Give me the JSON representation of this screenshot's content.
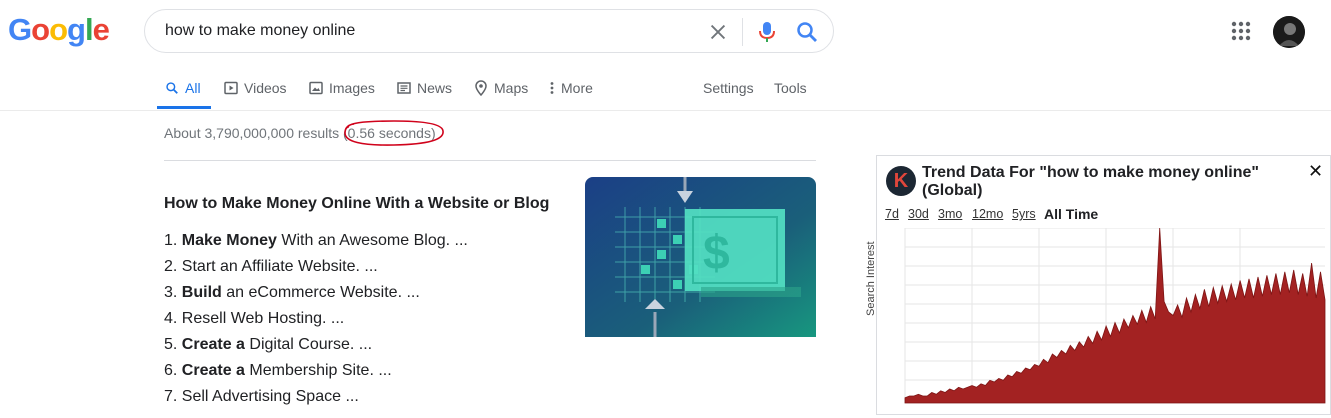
{
  "logo": {
    "letters": [
      "G",
      "o",
      "o",
      "g",
      "l",
      "e"
    ],
    "colors": [
      "#4285F4",
      "#EA4335",
      "#FBBC05",
      "#4285F4",
      "#34A853",
      "#EA4335"
    ]
  },
  "search": {
    "query": "how to make money online"
  },
  "icons": {
    "clear": "close-icon",
    "mic": "microphone-icon",
    "search": "search-icon",
    "apps": "apps-grid-icon"
  },
  "tabs": [
    {
      "label": "All",
      "icon": "search-icon"
    },
    {
      "label": "Videos",
      "icon": "play-icon"
    },
    {
      "label": "Images",
      "icon": "image-icon"
    },
    {
      "label": "News",
      "icon": "news-icon"
    },
    {
      "label": "Maps",
      "icon": "map-pin-icon"
    },
    {
      "label": "More",
      "icon": "more-vert-icon"
    }
  ],
  "tools": {
    "settings": "Settings",
    "tools": "Tools"
  },
  "stats": {
    "text": "About 3,790,000,000 results (0.56 seconds)"
  },
  "snippet": {
    "title": "How to Make Money Online With a Website or Blog",
    "items": [
      {
        "num": "1.",
        "bold": "Make Money",
        "rest": " With an Awesome Blog. ..."
      },
      {
        "num": "2.",
        "bold": "",
        "rest": "Start an Affiliate Website. ..."
      },
      {
        "num": "3.",
        "bold": "Build",
        "rest": " an eCommerce Website. ..."
      },
      {
        "num": "4.",
        "bold": "",
        "rest": "Resell Web Hosting. ..."
      },
      {
        "num": "5.",
        "bold": "Create a",
        "rest": " Digital Course. ..."
      },
      {
        "num": "6.",
        "bold": "Create a",
        "rest": " Membership Site. ..."
      },
      {
        "num": "7.",
        "bold": "",
        "rest": "Sell Advertising Space ..."
      }
    ]
  },
  "trend": {
    "logo_letter": "K",
    "title": "Trend Data For \"how to make money online\" (Global)",
    "close": "✕",
    "ranges": [
      "7d",
      "30d",
      "3mo",
      "12mo",
      "5yrs"
    ],
    "current_range": "All Time",
    "ylabel": "Search Interest",
    "color": "#a32222"
  },
  "chart_data": {
    "type": "area",
    "ylabel": "Search Interest",
    "ylim": [
      0,
      100
    ],
    "grid": true,
    "values": [
      3,
      4,
      4,
      5,
      4,
      4,
      6,
      5,
      7,
      6,
      8,
      7,
      9,
      8,
      9,
      10,
      9,
      11,
      10,
      13,
      12,
      14,
      13,
      16,
      15,
      18,
      17,
      20,
      19,
      22,
      21,
      25,
      23,
      28,
      26,
      30,
      28,
      33,
      30,
      35,
      32,
      38,
      34,
      41,
      36,
      44,
      38,
      46,
      40,
      48,
      43,
      50,
      45,
      53,
      46,
      55,
      48,
      100,
      58,
      52,
      50,
      56,
      49,
      60,
      52,
      62,
      54,
      65,
      55,
      66,
      57,
      67,
      58,
      68,
      59,
      70,
      60,
      71,
      60,
      72,
      61,
      73,
      62,
      74,
      62,
      75,
      63,
      76,
      62,
      74,
      61,
      80,
      60,
      75,
      59
    ]
  }
}
